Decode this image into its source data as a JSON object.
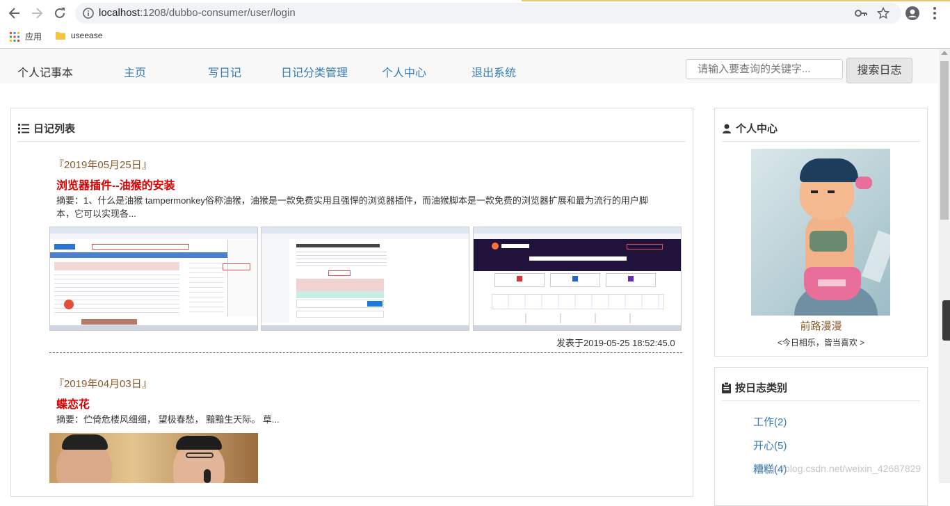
{
  "browser": {
    "url_host": "localhost",
    "url_path": ":1208/dubbo-consumer/user/login",
    "bookmarks": [
      {
        "label": "应用",
        "icon": "apps-grid-icon"
      },
      {
        "label": "useease",
        "icon": "folder-icon"
      }
    ]
  },
  "nav": {
    "brand": "个人记事本",
    "links": [
      "主页",
      "写日记",
      "日记分类管理",
      "个人中心",
      "退出系统"
    ],
    "search_placeholder": "请输入要查询的关键字...",
    "search_button": "搜索日志"
  },
  "diary_list": {
    "title": "日记列表",
    "entries": [
      {
        "date": "『2019年05月25日』",
        "title": "浏览器插件--油猴的安装",
        "summary": "摘要：1、什么是油猴 tampermonkey俗称油猴，油猴是一款免费实用且强悍的浏览器插件，而油猴脚本是一款免费的浏览器扩展和最为流行的用户脚本，它可以实现各...",
        "published": "发表于2019-05-25 18:52:45.0"
      },
      {
        "date": "『2019年04月03日』",
        "title": "蝶恋花",
        "summary": "摘要：伫倚危楼风细细， 望极春愁， 黯黯生天际。 草..."
      }
    ]
  },
  "profile": {
    "title": "个人中心",
    "nickname": "前路漫漫",
    "motto": "<今日相乐，皆当喜欢 >"
  },
  "categories": {
    "title": "按日志类别",
    "items": [
      "工作(2)",
      "开心(5)",
      "糟糕(4)"
    ]
  },
  "watermark": "https://blog.csdn.net/weixin_42687829"
}
